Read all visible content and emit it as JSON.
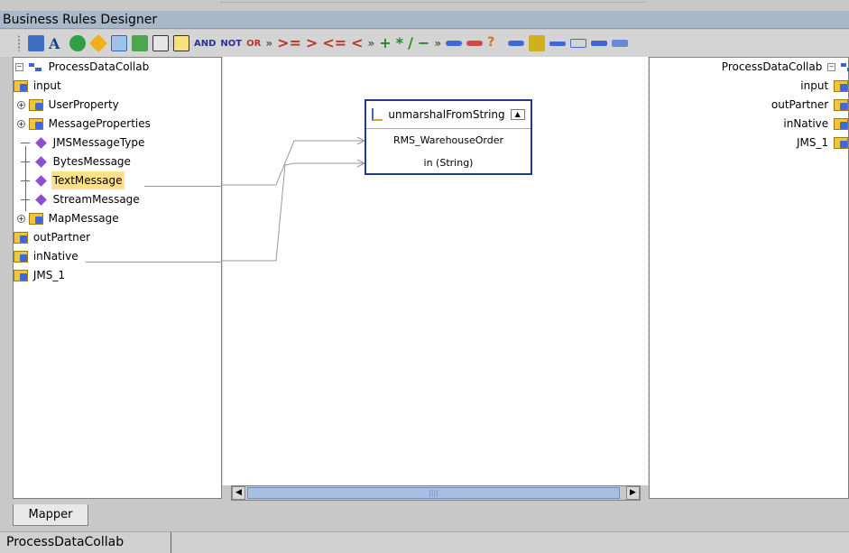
{
  "window": {
    "title": "Business Rules Designer"
  },
  "toolbar": {
    "text_buttons": [
      "AND",
      "NOT",
      "OR"
    ],
    "symbols": [
      "»",
      ">=",
      ">",
      "<=",
      "<",
      "»",
      "+",
      "*",
      "/",
      "−",
      "»"
    ]
  },
  "left_tree": {
    "root": "ProcessDataCollab",
    "items": [
      {
        "label": "input"
      },
      {
        "label": "UserProperty"
      },
      {
        "label": "MessageProperties"
      },
      {
        "label": "JMSMessageType"
      },
      {
        "label": "BytesMessage"
      },
      {
        "label": "TextMessage"
      },
      {
        "label": "StreamMessage"
      },
      {
        "label": "MapMessage"
      },
      {
        "label": "outPartner"
      },
      {
        "label": "inNative"
      },
      {
        "label": "JMS_1"
      }
    ]
  },
  "method_box": {
    "title": "unmarshalFromString",
    "params": [
      "RMS_WarehouseOrder",
      "in (String)"
    ]
  },
  "right_tree": {
    "root": "ProcessDataCollab",
    "items": [
      {
        "label": "input"
      },
      {
        "label": "outPartner"
      },
      {
        "label": "inNative"
      },
      {
        "label": "JMS_1"
      }
    ]
  },
  "tabs": {
    "mapper": "Mapper",
    "bottom": "ProcessDataCollab"
  },
  "colors": {
    "selection": "#ffe08a",
    "method_border": "#223a82",
    "title_bar": "#a8b8c8"
  }
}
